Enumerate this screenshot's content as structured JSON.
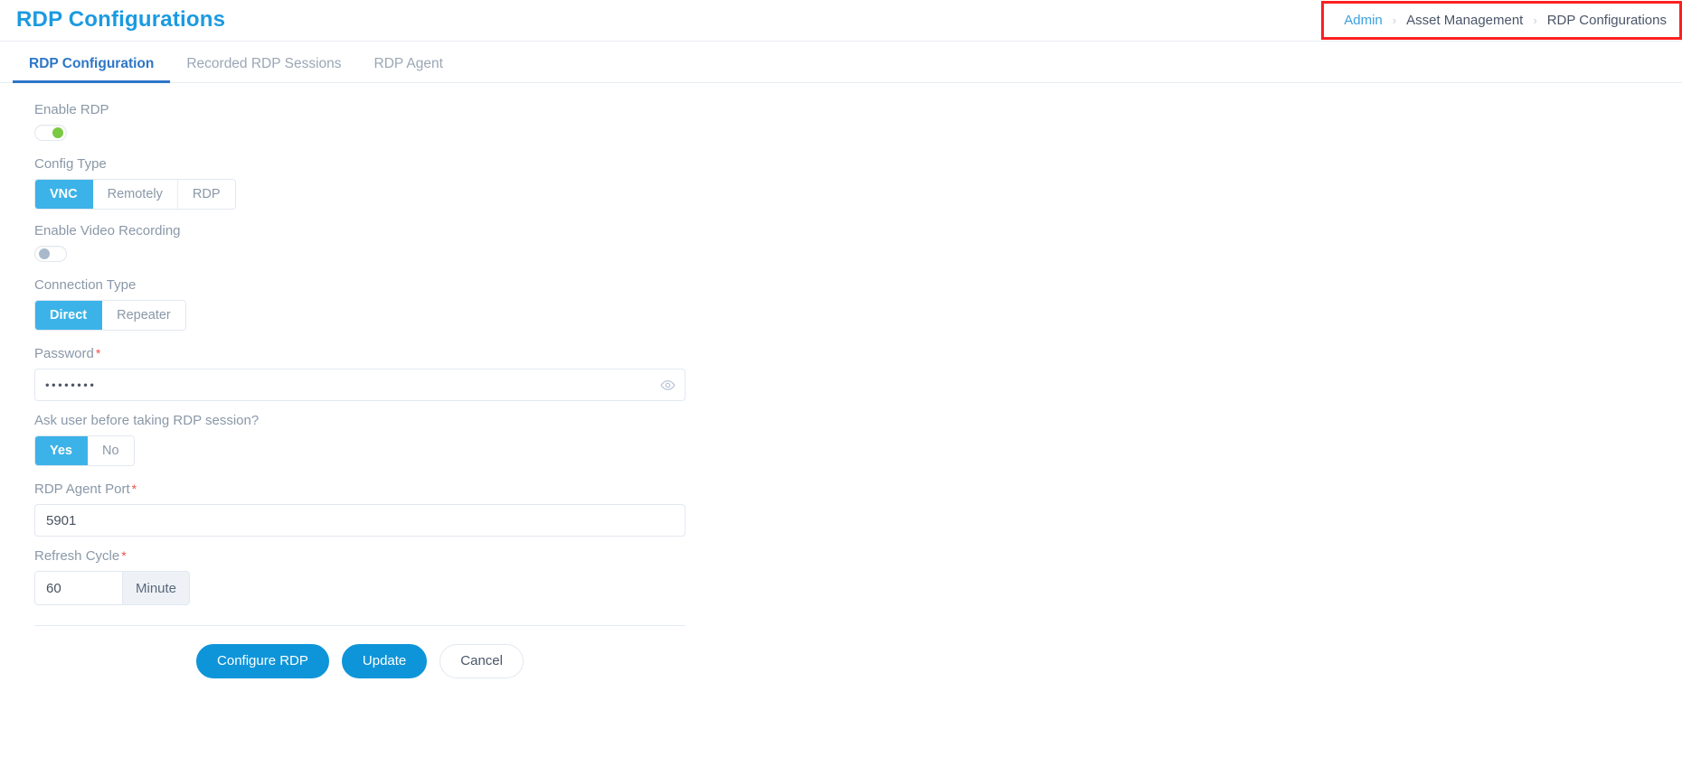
{
  "header": {
    "title": "RDP Configurations",
    "breadcrumb": [
      {
        "label": "Admin",
        "type": "link"
      },
      {
        "label": "Asset Management",
        "type": "text"
      },
      {
        "label": "RDP Configurations",
        "type": "text"
      }
    ],
    "separator": "›",
    "highlight_color": "#fc2020",
    "title_color": "#1b9ae0"
  },
  "tabs": [
    {
      "label": "RDP Configuration",
      "active": true
    },
    {
      "label": "Recorded RDP Sessions",
      "active": false
    },
    {
      "label": "RDP Agent",
      "active": false
    }
  ],
  "form": {
    "enable_rdp": {
      "label": "Enable RDP",
      "state": "on",
      "knob_color": "#7ac943"
    },
    "config_type": {
      "label": "Config Type",
      "options": [
        "VNC",
        "Remotely",
        "RDP"
      ],
      "selected": "VNC"
    },
    "enable_video_recording": {
      "label": "Enable Video Recording",
      "state": "off",
      "knob_color": "#a9b9ca"
    },
    "connection_type": {
      "label": "Connection Type",
      "options": [
        "Direct",
        "Repeater"
      ],
      "selected": "Direct"
    },
    "password": {
      "label": "Password",
      "required": "*",
      "value": "••••••••",
      "placeholder": "",
      "reveal_icon": "eye-icon"
    },
    "ask_user": {
      "label": "Ask user before taking RDP session?",
      "options": [
        "Yes",
        "No"
      ],
      "selected": "Yes"
    },
    "rdp_agent_port": {
      "label": "RDP Agent Port",
      "required": "*",
      "value": "5901",
      "placeholder": ""
    },
    "refresh_cycle": {
      "label": "Refresh Cycle",
      "required": "*",
      "value": "60",
      "unit": "Minute"
    }
  },
  "actions": {
    "configure": "Configure RDP",
    "update": "Update",
    "cancel": "Cancel",
    "primary_color": "#0e95d9",
    "accent_color": "#3cb3e8"
  }
}
